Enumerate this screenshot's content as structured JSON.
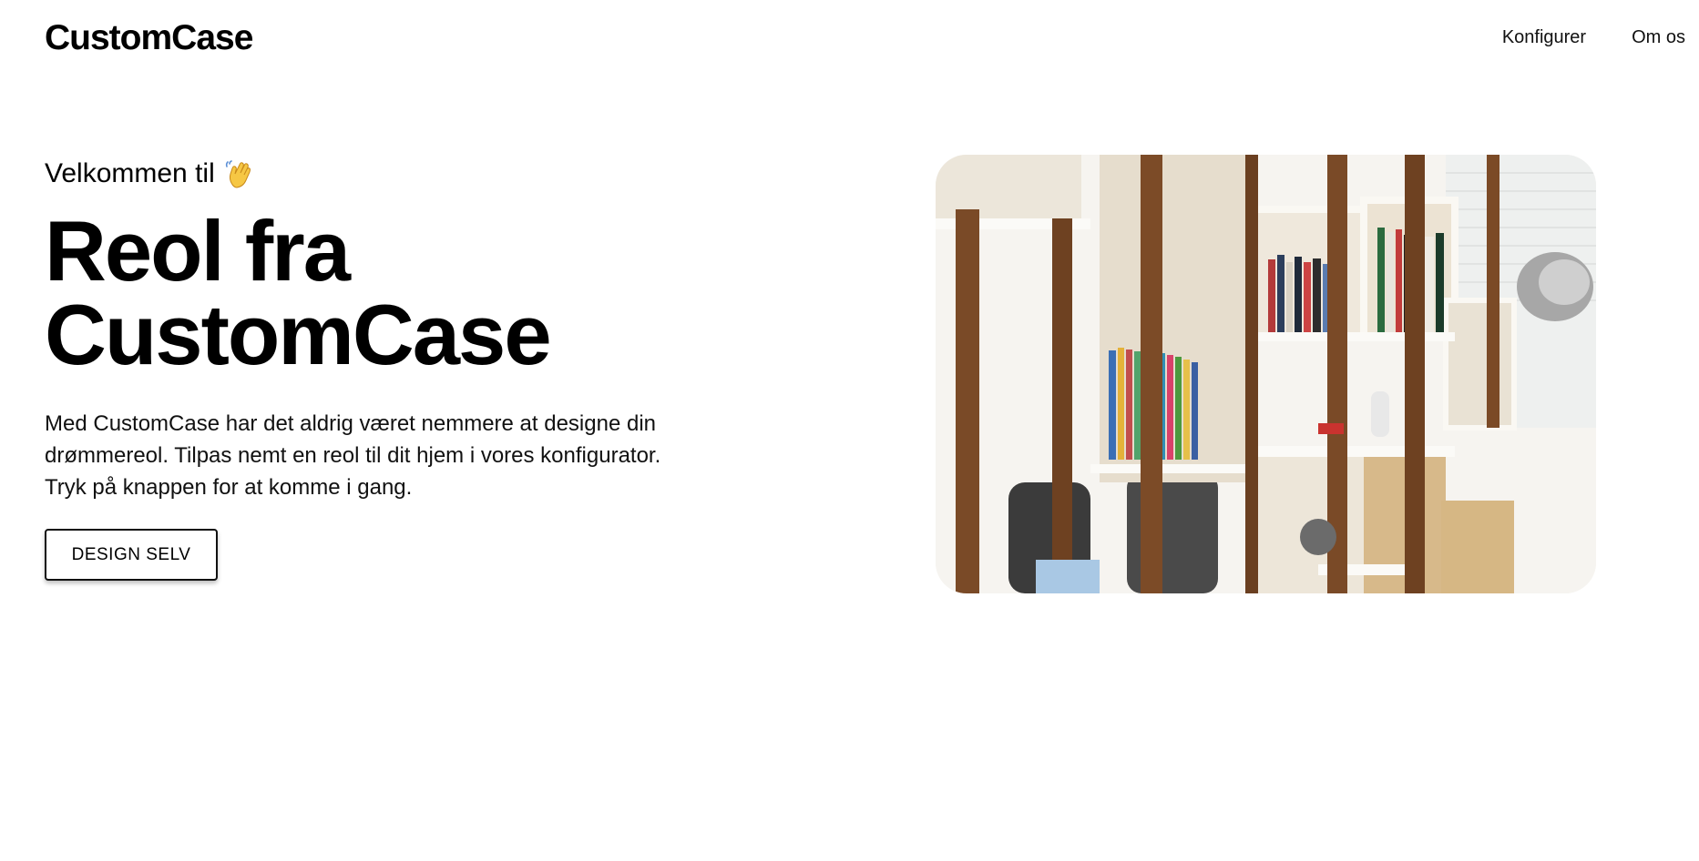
{
  "header": {
    "logo": "CustomCase",
    "nav": [
      {
        "label": "Konfigurer"
      },
      {
        "label": "Om os"
      }
    ]
  },
  "hero": {
    "greeting": "Velkommen til",
    "greeting_icon": "waving-hand-icon",
    "headline_line1": "Reol fra",
    "headline_line2": "CustomCase",
    "body_line1": "Med CustomCase har det aldrig været nemmere at designe din",
    "body_line2": "drømmereol. Tilpas nemt en reol til dit hjem i vores konfigurator.",
    "body_line3": "Tryk på knappen for at komme i gang.",
    "cta_label": "DESIGN SELV",
    "image_subject": "bookshelf-photo"
  },
  "colors": {
    "text": "#000000",
    "background": "#ffffff",
    "wood_dark": "#7a4a27",
    "shelf_white": "#efeae1"
  }
}
